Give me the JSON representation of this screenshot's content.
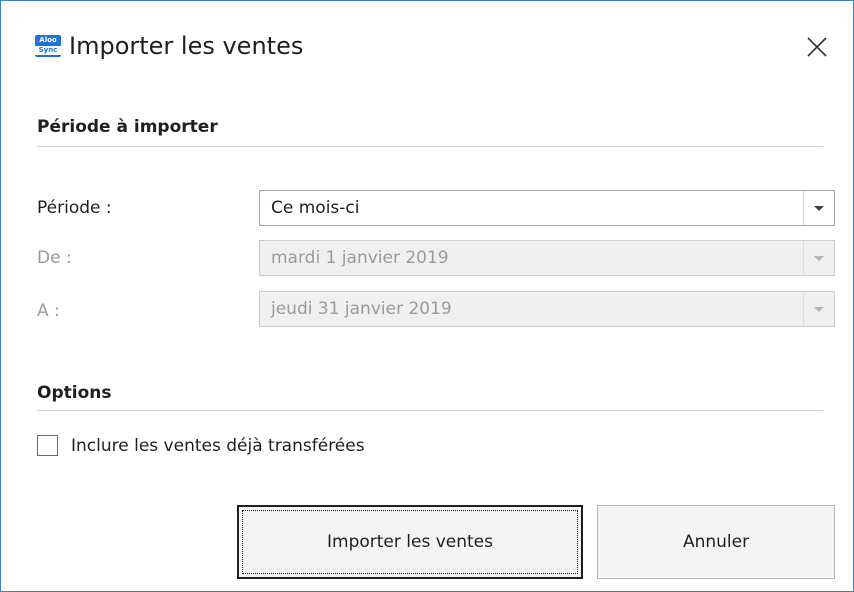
{
  "window": {
    "title": "Importer les ventes",
    "app_icon_top": "Aloo",
    "app_icon_bottom": "Sync"
  },
  "period_section": {
    "title": "Période à importer",
    "period": {
      "label": "Période :",
      "value": "Ce mois-ci"
    },
    "from": {
      "label": "De :",
      "value": "mardi 1 janvier 2019"
    },
    "to": {
      "label": "A :",
      "value": "jeudi 31 janvier 2019"
    }
  },
  "options_section": {
    "title": "Options",
    "include_transferred": {
      "label": "Inclure les ventes déjà transférées",
      "checked": false
    }
  },
  "buttons": {
    "import_label": "Importer les ventes",
    "cancel_label": "Annuler"
  },
  "colors": {
    "window_border": "#3c7fc7",
    "app_icon": "#1e73d8",
    "disabled_text": "#9a9a9a"
  }
}
